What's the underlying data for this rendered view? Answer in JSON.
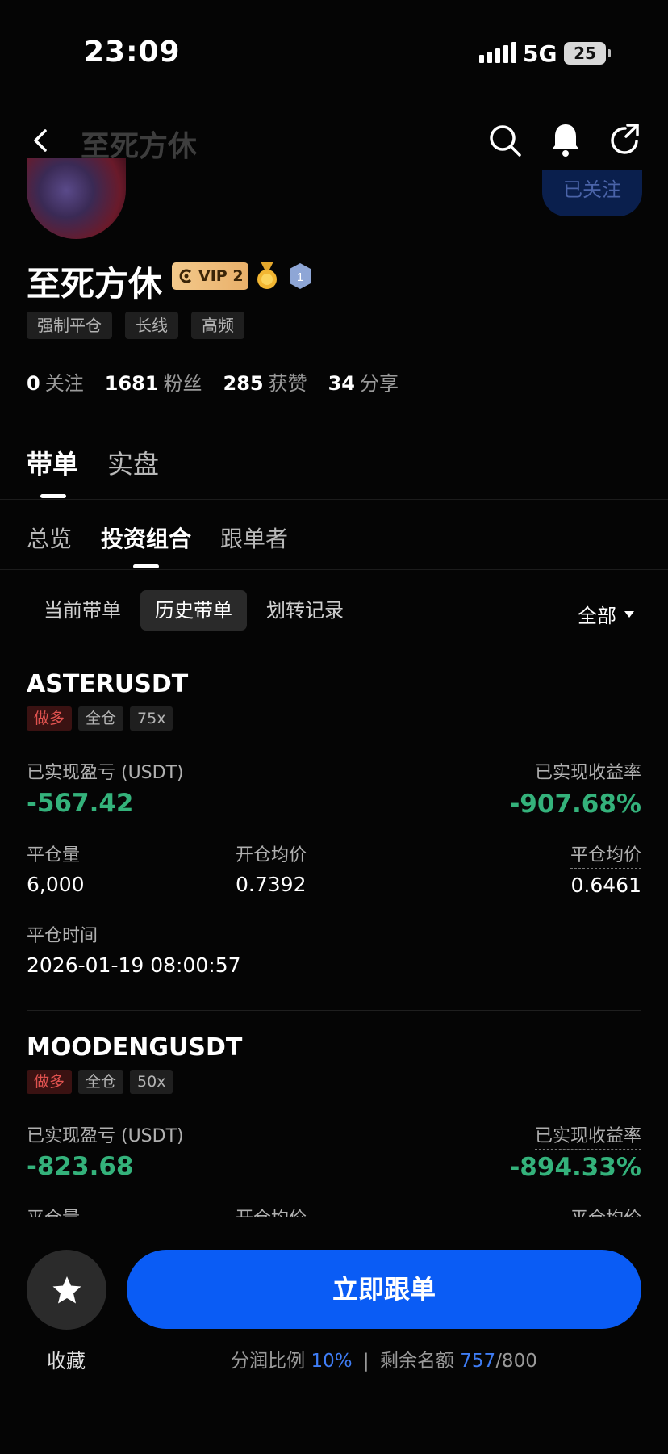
{
  "status_bar": {
    "time": "23:09",
    "network": "5G",
    "battery": "25"
  },
  "nav": {
    "title": "至死方休"
  },
  "profile": {
    "name": "至死方休",
    "vip_label": "VIP 2",
    "level": "1",
    "follow_button": "已关注",
    "tags": [
      "强制平仓",
      "长线",
      "高频"
    ],
    "stats": [
      {
        "value": "0",
        "label": "关注"
      },
      {
        "value": "1681",
        "label": "粉丝"
      },
      {
        "value": "285",
        "label": "获赞"
      },
      {
        "value": "34",
        "label": "分享"
      }
    ]
  },
  "main_tabs": [
    "带单",
    "实盘"
  ],
  "sub_tabs": [
    "总览",
    "投资组合",
    "跟单者"
  ],
  "filter_tabs": [
    "当前带单",
    "历史带单",
    "划转记录"
  ],
  "filter_dropdown": "全部",
  "labels": {
    "realized_pnl": "已实现盈亏 (USDT)",
    "realized_rate": "已实现收益率",
    "close_qty": "平仓量",
    "open_avg": "开仓均价",
    "close_avg": "平仓均价",
    "close_time": "平仓时间"
  },
  "positions": [
    {
      "symbol": "ASTERUSDT",
      "side": "做多",
      "margin": "全仓",
      "leverage": "75x",
      "pnl": "-567.42",
      "rate": "-907.68%",
      "close_qty": "6,000",
      "open_avg": "0.7392",
      "close_avg": "0.6461",
      "close_time": "2026-01-19 08:00:57"
    },
    {
      "symbol": "MOODENGUSDT",
      "side": "做多",
      "margin": "全仓",
      "leverage": "50x",
      "pnl": "-823.68",
      "rate": "-894.33%"
    }
  ],
  "bottom": {
    "favorite_label": "收藏",
    "follow_now": "立即跟单",
    "profit_share_label": "分润比例",
    "profit_share_value": "10%",
    "remaining_label": "剩余名额",
    "remaining_value": "757",
    "remaining_total": "/800"
  },
  "colors": {
    "accent": "#0a5cf5",
    "profit_negative_green": "#34b27b",
    "long_red": "#e0524f"
  }
}
